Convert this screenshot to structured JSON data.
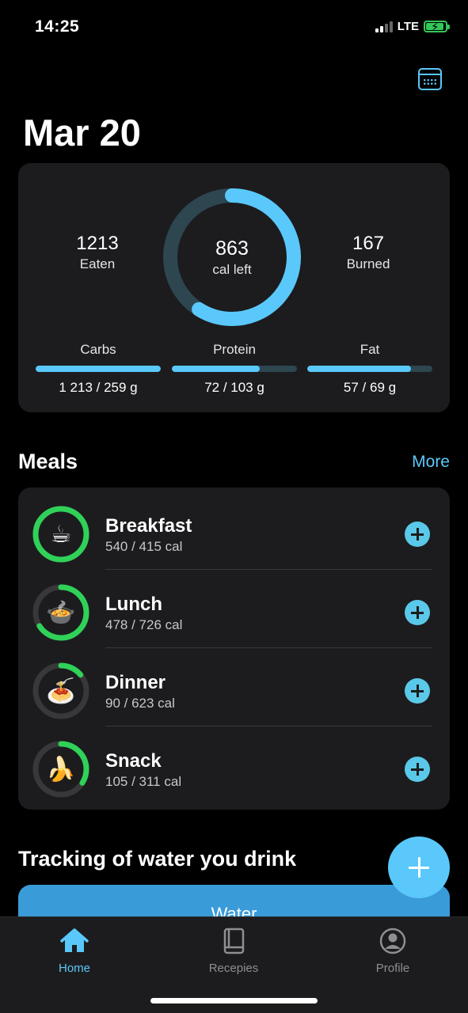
{
  "status_bar": {
    "time": "14:25",
    "network": "LTE"
  },
  "header": {
    "date": "Mar 20",
    "calendar_icon": "calendar-icon"
  },
  "summary": {
    "eaten_value": "1213",
    "eaten_label": "Eaten",
    "left_value": "863",
    "left_label": "cal left",
    "burned_value": "167",
    "burned_label": "Burned",
    "ring_progress": 0.59,
    "macros": [
      {
        "name": "Carbs",
        "value": "1 213 / 259 g",
        "progress": 1.0
      },
      {
        "name": "Protein",
        "value": "72 / 103 g",
        "progress": 0.7
      },
      {
        "name": "Fat",
        "value": "57 / 69 g",
        "progress": 0.83
      }
    ]
  },
  "meals_section": {
    "title": "Meals",
    "more_label": "More",
    "items": [
      {
        "name": "Breakfast",
        "calories": "540 / 415 cal",
        "progress": 1.0,
        "icon": "☕"
      },
      {
        "name": "Lunch",
        "calories": "478 / 726 cal",
        "progress": 0.66,
        "icon": "🍲"
      },
      {
        "name": "Dinner",
        "calories": "90 / 623 cal",
        "progress": 0.14,
        "icon": "🍝"
      },
      {
        "name": "Snack",
        "calories": "105 / 311 cal",
        "progress": 0.34,
        "icon": "🍌"
      }
    ]
  },
  "water_section": {
    "title": "Tracking of water you drink",
    "button_label": "Water"
  },
  "tab_bar": {
    "tabs": [
      {
        "label": "Home",
        "active": true,
        "icon": "home-icon"
      },
      {
        "label": "Recepies",
        "active": false,
        "icon": "book-icon"
      },
      {
        "label": "Profile",
        "active": false,
        "icon": "profile-icon"
      }
    ]
  },
  "colors": {
    "accent": "#5ac8fa",
    "green": "#30d158",
    "card": "#1c1c1e",
    "track": "#2d4650"
  }
}
